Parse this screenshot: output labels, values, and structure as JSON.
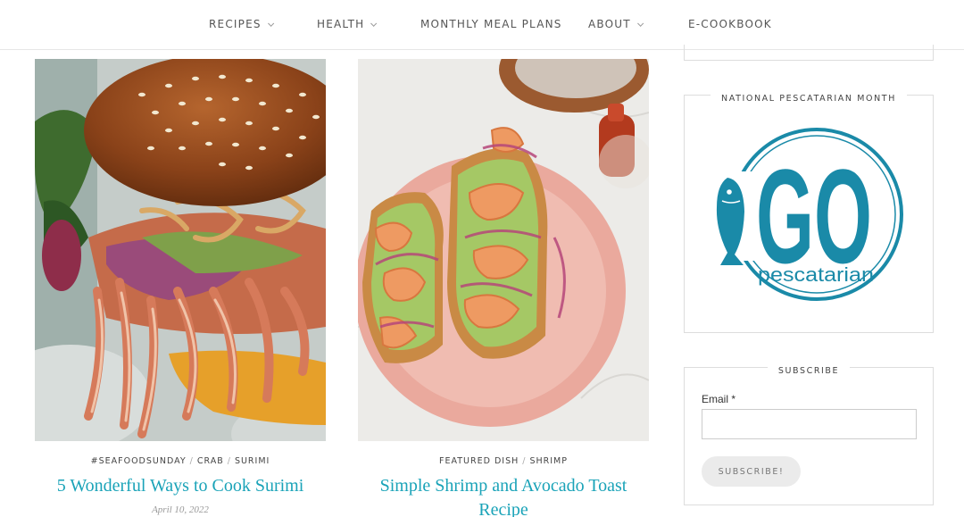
{
  "nav": {
    "items": [
      {
        "label": "RECIPES",
        "has_dropdown": true
      },
      {
        "label": "HEALTH",
        "has_dropdown": true
      },
      {
        "label": "MONTHLY MEAL PLANS",
        "has_dropdown": false
      },
      {
        "label": "ABOUT",
        "has_dropdown": true
      },
      {
        "label": "E-COOKBOOK",
        "has_dropdown": false
      }
    ]
  },
  "posts": [
    {
      "categories": [
        "#SEAFOODSUNDAY",
        "CRAB",
        "SURIMI"
      ],
      "title": "5 Wonderful Ways to Cook Surimi",
      "date": "April 10, 2022",
      "image": "surimi-sandwich-photo"
    },
    {
      "categories": [
        "FEATURED DISH",
        "SHRIMP"
      ],
      "title": "Simple Shrimp and Avocado Toast Recipe",
      "image": "shrimp-avocado-toast-photo"
    }
  ],
  "sidebar": {
    "pescatarian_widget": {
      "title": "NATIONAL PESCATARIAN MONTH",
      "logo": {
        "big_text": "GO",
        "sub_text": "pescatarian",
        "color": "#1a8aa8"
      }
    },
    "subscribe_widget": {
      "title": "SUBSCRIBE",
      "email_label": "Email",
      "required_mark": "*",
      "email_value": "",
      "button_label": "SUBSCRIBE!"
    }
  },
  "colors": {
    "accent": "#1aa3b8",
    "logo_blue": "#1a8aa8",
    "nav_text": "#555555",
    "border": "#dddddd"
  }
}
